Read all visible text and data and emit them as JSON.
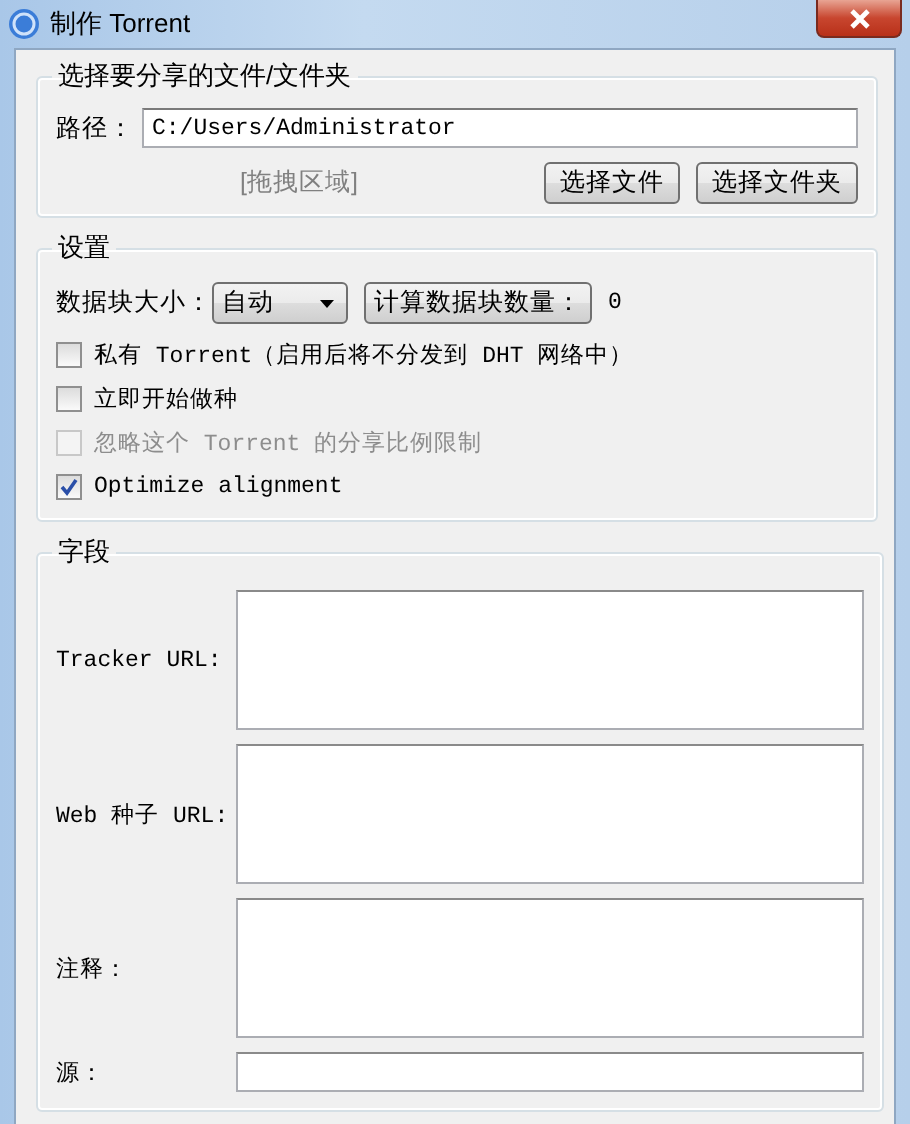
{
  "window": {
    "title": "制作 Torrent"
  },
  "file_group": {
    "title": "选择要分享的文件/文件夹",
    "path_label": "路径：",
    "path_value": "C:/Users/Administrator",
    "drop_hint": "[拖拽区域]",
    "buttons": [
      "选择文件",
      "选择文件夹"
    ]
  },
  "settings": {
    "title": "设置",
    "piece_size_label": "数据块大小：",
    "piece_size_value": "自动",
    "calc_button": "计算数据块数量：",
    "piece_count": "0",
    "options": [
      {
        "label": "私有 Torrent（启用后将不分发到 DHT 网络中）",
        "checked": false,
        "disabled": false
      },
      {
        "label": "立即开始做种",
        "checked": false,
        "disabled": false
      },
      {
        "label": "忽略这个 Torrent 的分享比例限制",
        "checked": false,
        "disabled": true
      },
      {
        "label": "Optimize alignment",
        "checked": true,
        "disabled": false
      }
    ]
  },
  "fields": {
    "title": "字段",
    "rows": [
      {
        "label": "Tracker URL:",
        "kind": "multiline"
      },
      {
        "label": "Web 种子 URL:",
        "kind": "multiline"
      },
      {
        "label": "注释：",
        "kind": "multiline"
      },
      {
        "label": "源：",
        "kind": "single"
      }
    ]
  }
}
